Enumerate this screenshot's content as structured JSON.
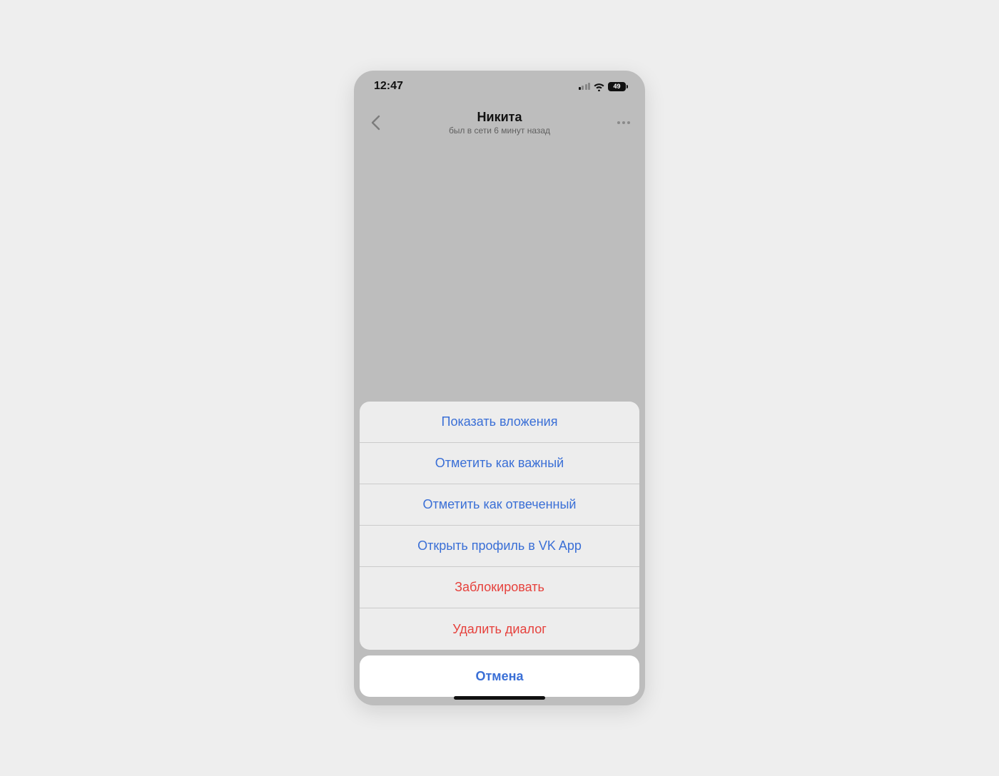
{
  "status": {
    "time": "12:47",
    "battery_label": "49"
  },
  "chat": {
    "title": "Никита",
    "subtitle": "был в сети 6 минут назад"
  },
  "sheet": {
    "items": [
      {
        "label": "Показать вложения",
        "destructive": false
      },
      {
        "label": "Отметить как важный",
        "destructive": false
      },
      {
        "label": "Отметить как отвеченный",
        "destructive": false
      },
      {
        "label": "Открыть профиль в VK App",
        "destructive": false
      },
      {
        "label": "Заблокировать",
        "destructive": true
      },
      {
        "label": "Удалить диалог",
        "destructive": true
      }
    ],
    "cancel_label": "Отмена"
  }
}
